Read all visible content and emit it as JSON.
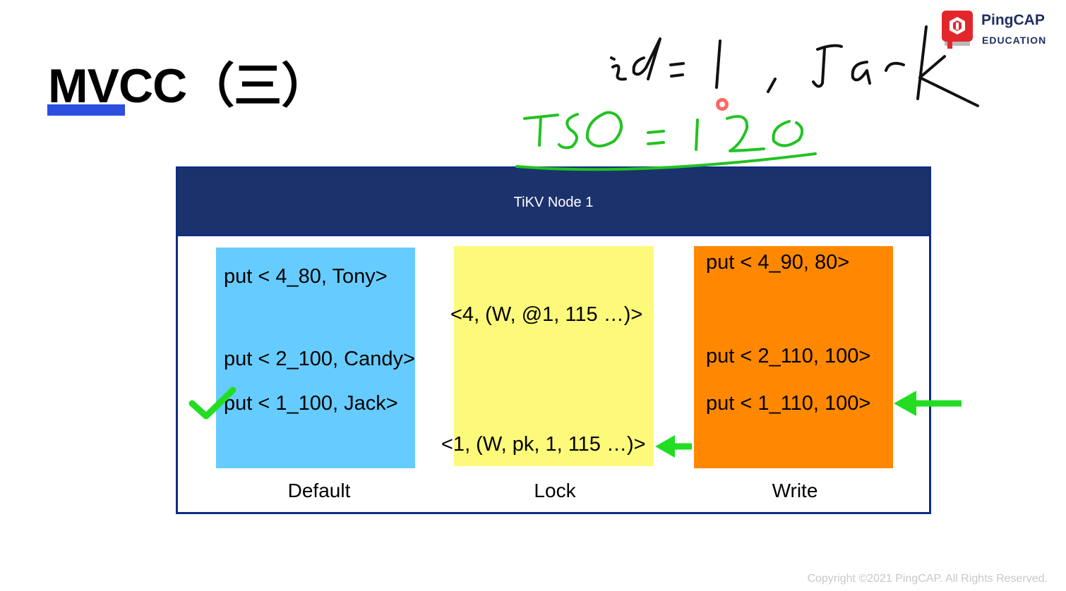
{
  "slide": {
    "title": "MVCC（三）",
    "copyright": "Copyright ©2021 PingCAP. All Rights Reserved."
  },
  "logo": {
    "name": "PingCAP",
    "subtitle": "EDUCATION",
    "icon": "pingcap-logo-icon",
    "color": "#e3262c"
  },
  "annotations": {
    "handwritten_top": "id=1 , Jack",
    "handwritten_tso": "TSO = 120",
    "ink_black": "#111111",
    "ink_green": "#22c322"
  },
  "diagram": {
    "node_title": "TiKV Node 1",
    "colors": {
      "node_header": "#1c326c",
      "node_border": "#0f2d83",
      "default_cf": "#66ccff",
      "lock_cf": "#fdf97a",
      "write_cf": "#ff8800",
      "arrow": "#22dd22"
    },
    "default": {
      "label": "Default",
      "entries": [
        "put < 4_80, Tony>",
        "put < 2_100, Candy>",
        "put < 1_100, Jack>"
      ]
    },
    "lock": {
      "label": "Lock",
      "entries": [
        "<4, (W, @1, 115 …)>",
        "<1, (W, pk, 1, 115 …)>"
      ]
    },
    "write": {
      "label": "Write",
      "entries": [
        "put < 4_90, 80>",
        "put < 2_110, 100>",
        "put < 1_110, 100>"
      ]
    }
  }
}
